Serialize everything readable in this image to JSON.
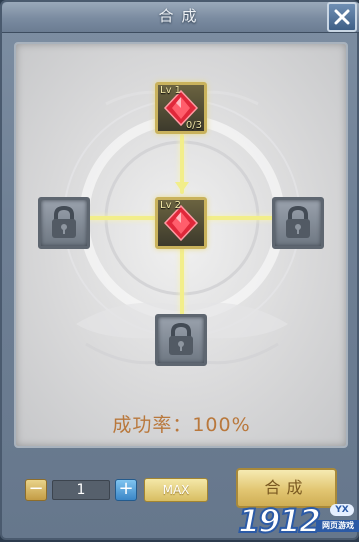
{
  "window": {
    "title": "合成"
  },
  "icons": {
    "close": "close-icon",
    "lock": "lock-icon",
    "gem": "red-gem-icon"
  },
  "material_slot": {
    "level": "Lv 1",
    "count": "0/3"
  },
  "result_slot": {
    "level": "Lv 2"
  },
  "success_rate": "成功率：100%",
  "quantity": {
    "minus_label": "−",
    "value": "1",
    "plus_label": "+",
    "max_label": "MAX"
  },
  "combine_label": "合成",
  "watermark": {
    "number": "1912",
    "badge": "YX",
    "subtitle": "网页游戏"
  },
  "colors": {
    "gem": "#e0283a",
    "gold_border": "#c9b25c",
    "connector": "#f2ee8a",
    "rate_text": "#b9783c"
  }
}
